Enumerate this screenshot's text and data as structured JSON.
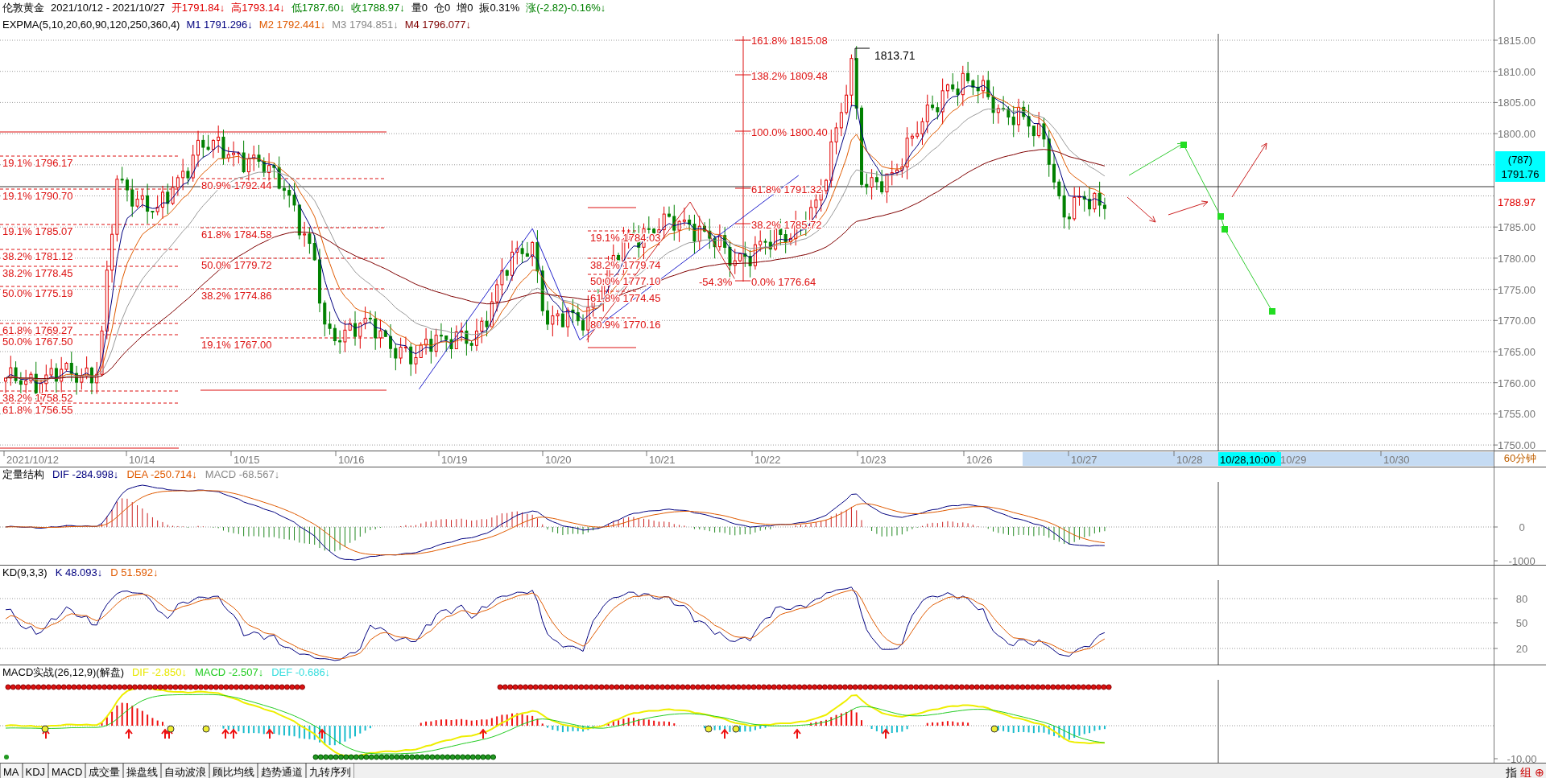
{
  "header": {
    "line1": [
      {
        "text": "伦敦黄金"
      },
      {
        "text": "2021/10/12 - 2021/10/27"
      },
      {
        "text": "开1791.84↓",
        "color": "#e00000"
      },
      {
        "text": "高1793.14↓",
        "color": "#e00000"
      },
      {
        "text": "低1787.60↓",
        "color": "#008000"
      },
      {
        "text": "收1788.97↓",
        "color": "#008000"
      },
      {
        "text": "量0"
      },
      {
        "text": "仓0"
      },
      {
        "text": "增0"
      },
      {
        "text": "振0.31%"
      },
      {
        "text": "涨(-2.82)-0.16%↓",
        "color": "#008000"
      }
    ],
    "line2": [
      {
        "text": "EXPMA(5,10,20,60,90,120,250,360,4)"
      },
      {
        "text": "M1 1791.296↓",
        "color": "#00007f"
      },
      {
        "text": "M2 1792.441↓",
        "color": "#e05a00"
      },
      {
        "text": "M3 1794.851↓",
        "color": "#8a8a8a"
      },
      {
        "text": "M4 1796.077↓",
        "color": "#7f0000"
      }
    ]
  },
  "price_panel": {
    "fib_groups": [
      {
        "labels": [
          "19.1% 1796.17",
          "19.1% 1790.70",
          "19.1% 1785.07",
          "38.2% 1781.12",
          "38.2% 1778.45",
          "50.0% 1775.19",
          "61.8% 1769.27",
          "50.0% 1767.50",
          "38.2% 1758.52",
          "61.8% 1756.55"
        ]
      },
      {
        "labels": [
          "80.9% 1792.44",
          "61.8% 1784.58",
          "50.0% 1779.72",
          "38.2% 1774.86",
          "19.1% 1767.00"
        ]
      },
      {
        "labels": [
          "19.1% 1784.03",
          "38.2% 1779.74",
          "50.0% 1777.10",
          "61.8% 1774.45",
          "80.9% 1770.16"
        ]
      },
      {
        "labels": [
          "161.8% 1815.08",
          "138.2% 1809.48",
          "100.0% 1800.40",
          "61.8% 1791.32",
          "38.2% 1785.72",
          "-54.3%",
          "0.0% 1776.64"
        ]
      }
    ],
    "peak_label": "1813.71",
    "axis_labels": [
      "1815.00",
      "1810.00",
      "1805.00",
      "1800.00",
      "1785.00",
      "1780.00",
      "1775.00",
      "1770.00",
      "1765.00",
      "1760.00",
      "1755.00",
      "1750.00"
    ],
    "last_price": {
      "count": "(787)",
      "price": "1791.76"
    },
    "close_price": "1788.97"
  },
  "time_axis": {
    "dates": [
      "2021/10/12",
      "10/14",
      "10/15",
      "10/16",
      "10/19",
      "10/20",
      "10/21",
      "10/22",
      "10/23",
      "10/26",
      "10/27",
      "10/28",
      "10/29",
      "10/30"
    ],
    "cursor_label": "10/28,10:00",
    "period": "60分钟"
  },
  "panels": [
    {
      "kind": "macd",
      "title_items": [
        {
          "text": "定量结构"
        },
        {
          "text": "DIF -284.998↓",
          "color": "#00007f"
        },
        {
          "text": "DEA -250.714↓",
          "color": "#e05a00"
        },
        {
          "text": "MACD -68.567↓",
          "color": "#8a8a8a"
        }
      ],
      "axis_labels": [
        "0",
        "-1000"
      ]
    },
    {
      "kind": "kd",
      "title_items": [
        {
          "text": "KD(9,3,3)"
        },
        {
          "text": "K 48.093↓",
          "color": "#00007f"
        },
        {
          "text": "D 51.592↓",
          "color": "#e05a00"
        }
      ],
      "axis_labels": [
        "80",
        "50",
        "20"
      ]
    },
    {
      "kind": "signal",
      "title_items": [
        {
          "text": "MACD实战(26,12,9)(解盘)"
        },
        {
          "text": "DIF -2.850↓",
          "color": "#e8e800"
        },
        {
          "text": "MACD -2.507↓",
          "color": "#22cc22"
        },
        {
          "text": "DEF -0.686↓",
          "color": "#33dddd"
        }
      ],
      "axis_labels": [
        "-10.00"
      ]
    }
  ],
  "tabs": [
    {
      "label": "MA",
      "selected": false
    },
    {
      "label": "KDJ",
      "selected": false
    },
    {
      "label": "MACD",
      "selected": false
    },
    {
      "label": "成交量",
      "selected": false
    },
    {
      "label": "操盘线",
      "selected": false
    },
    {
      "label": "自动波浪",
      "selected": false
    },
    {
      "label": "顾比均线",
      "selected": false
    },
    {
      "label": "趋势通道",
      "selected": false
    },
    {
      "label": "九转序列",
      "selected": false
    }
  ],
  "corner": [
    {
      "text": "指"
    },
    {
      "text": "组",
      "color": "#cc0000"
    },
    {
      "text": "⊕",
      "color": "#cc0000"
    }
  ]
}
